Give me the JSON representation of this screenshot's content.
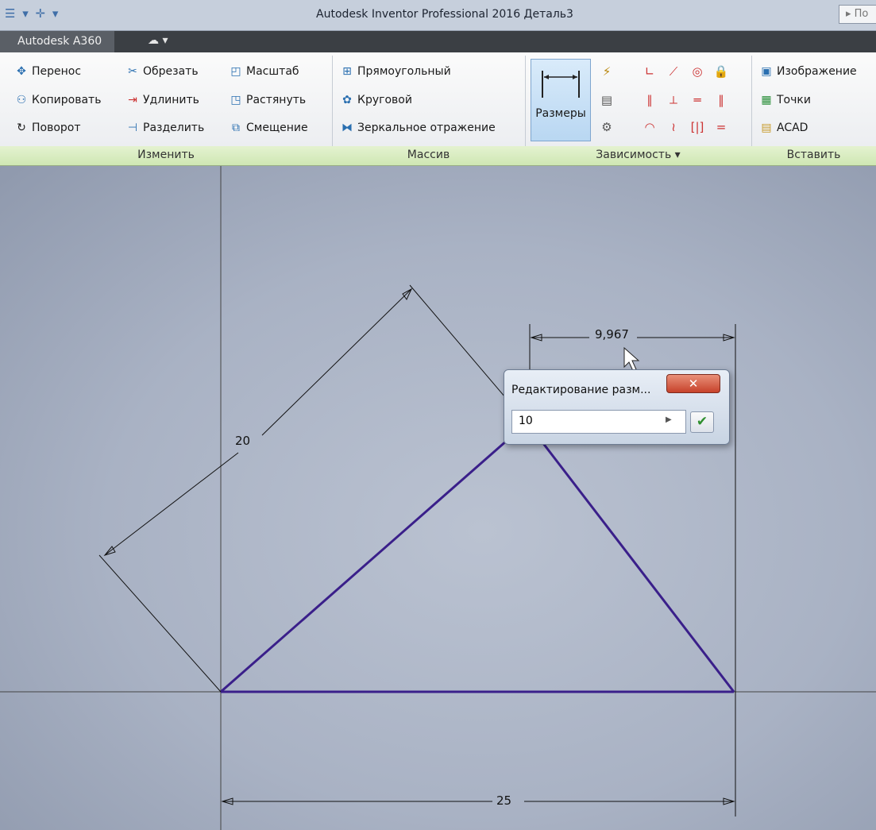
{
  "app": {
    "qat_icons": "☰ ▾ ✛ ▾",
    "title": "Autodesk Inventor Professional 2016   Деталь3",
    "search_prefix": "▸ По"
  },
  "menubar": {
    "a360": "Autodesk A360",
    "cloud": "☁ ▾"
  },
  "ribbon": {
    "modify": {
      "label": "Изменить",
      "move": "Перенос",
      "copy": "Копировать",
      "rotate": "Поворот",
      "trim": "Обрезать",
      "extend": "Удлинить",
      "split": "Разделить",
      "scale": "Масштаб",
      "stretch": "Растянуть",
      "offset": "Смещение"
    },
    "pattern": {
      "label": "Массив",
      "rectangular": "Прямоугольный",
      "circular": "Круговой",
      "mirror": "Зеркальное отражение"
    },
    "constrain": {
      "label": "Зависимость ▾",
      "dimension": "Размеры"
    },
    "insert": {
      "label": "Вставить",
      "image": "Изображение",
      "points": "Точки",
      "acad": "ACAD"
    }
  },
  "sketch": {
    "dim_top": "9,967",
    "dim_slant": "20",
    "dim_bottom": "25"
  },
  "dialog": {
    "title": "Редактирование разм...",
    "value": "10",
    "close": "✕",
    "ok": "✔"
  }
}
